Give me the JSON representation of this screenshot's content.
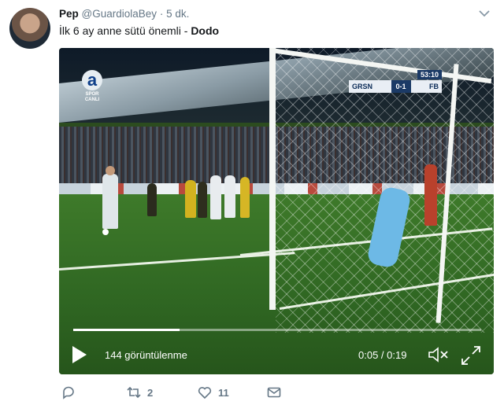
{
  "tweet": {
    "author_name": "Pep",
    "author_handle": "@GuardiolaBey",
    "separator": "·",
    "time": "5 dk.",
    "text": "İlk 6 ay anne sütü önemli - ",
    "text_bold": "Dodo"
  },
  "video": {
    "channel_logo": "a",
    "channel_logo_sub1": "SPOR",
    "channel_logo_sub2": "CANLI",
    "scoreboard": {
      "clock": "53:10",
      "home": "GRSN",
      "score": "0-1",
      "away": "FB"
    },
    "progress_fraction": 0.26,
    "views": "144 görüntülenme",
    "timecode": "0:05 / 0:19"
  },
  "actions": {
    "reply_count": "",
    "retweet_count": "2",
    "like_count": "11"
  },
  "icons": [
    "caret-down-icon",
    "play-icon",
    "mute-icon",
    "fullscreen-icon",
    "reply-icon",
    "retweet-icon",
    "like-icon",
    "message-icon"
  ],
  "colors": {
    "text": "#14171a",
    "muted": "#657786",
    "white": "#ffffff"
  }
}
